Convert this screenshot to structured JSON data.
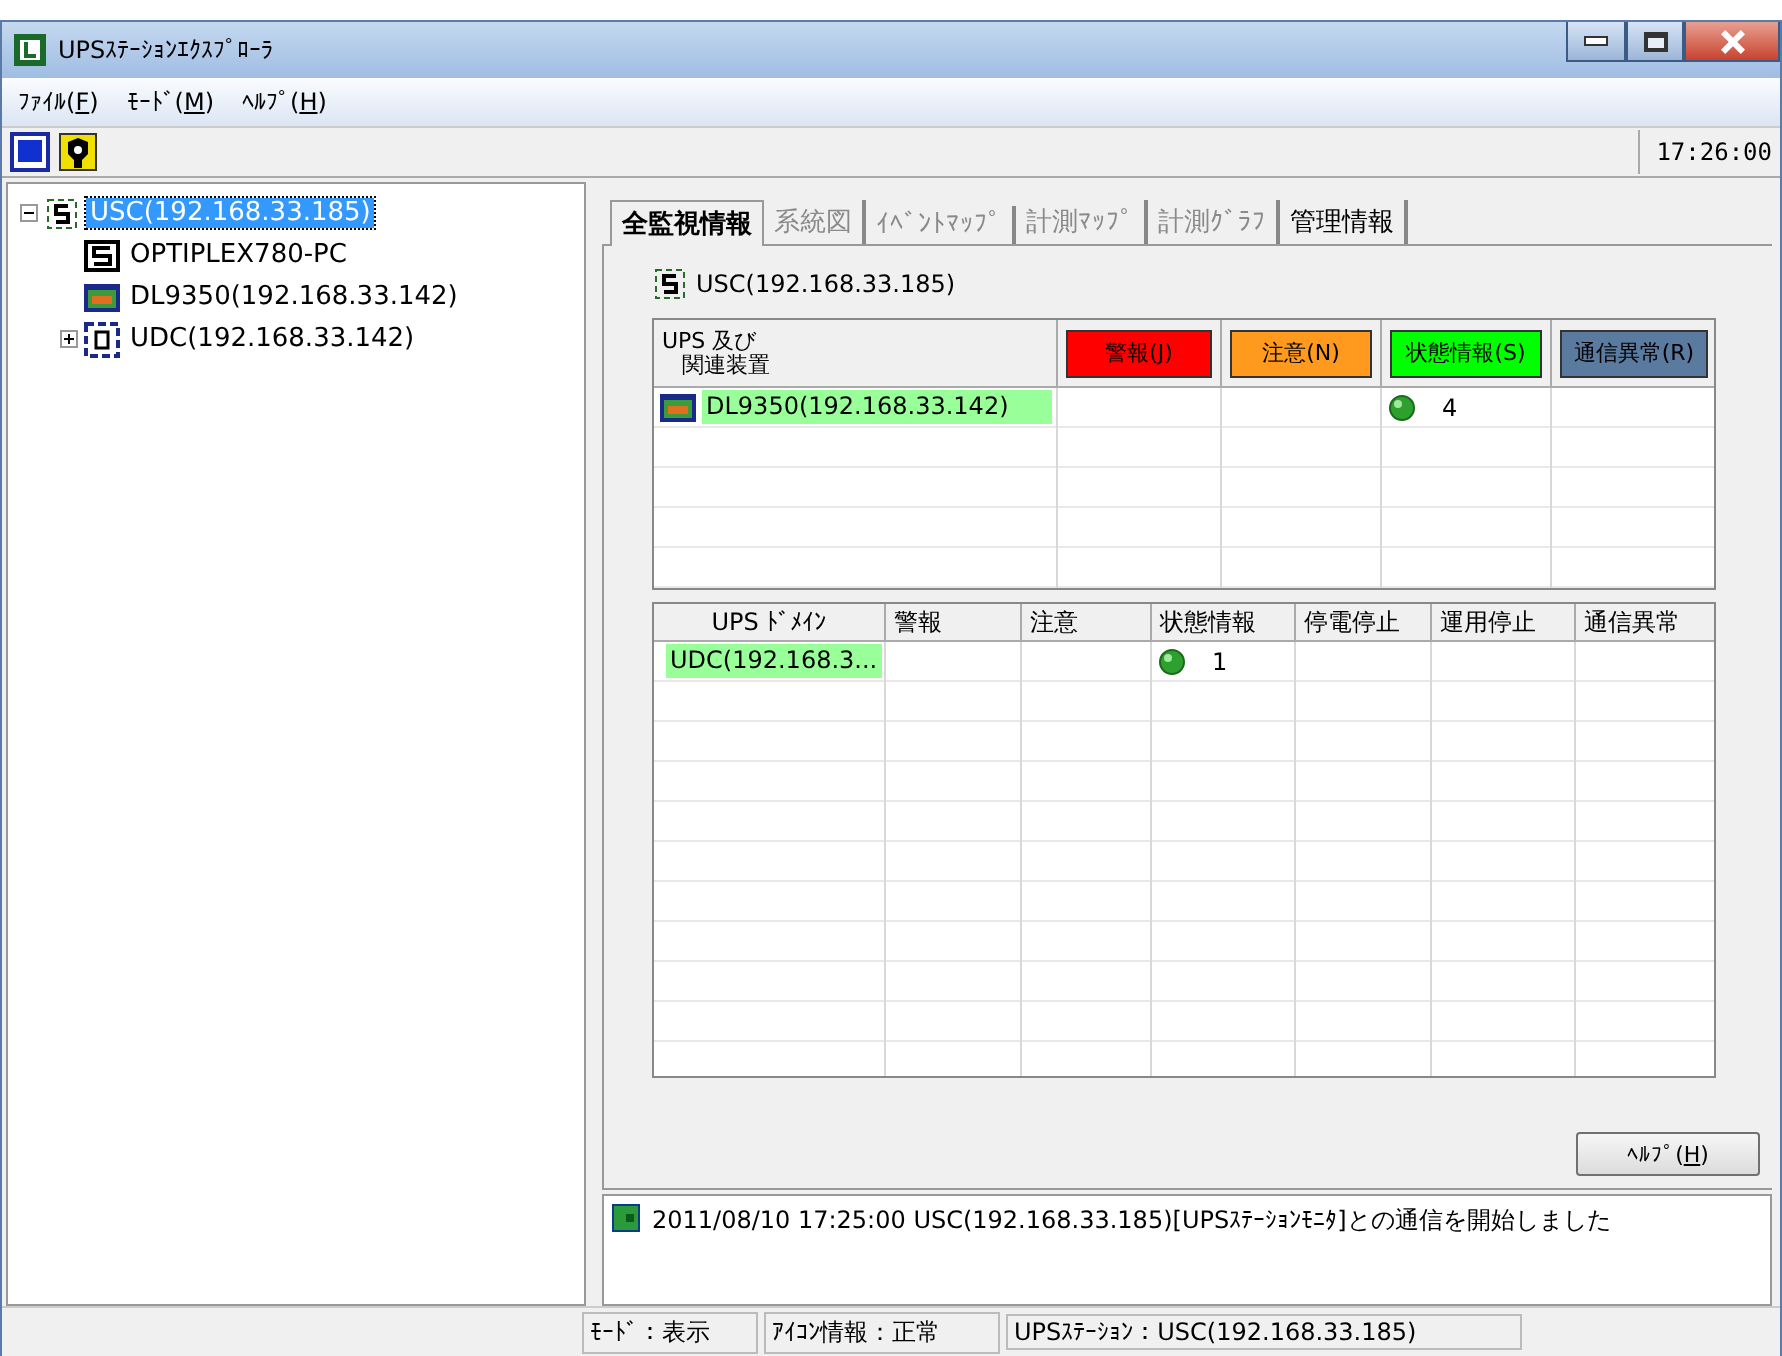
{
  "window": {
    "title": "UPSｽﾃｰｼｮﾝｴｸｽﾌﾟﾛｰﾗ"
  },
  "menu": [
    {
      "prefix": "ﾌｧｲﾙ(",
      "key": "F",
      "suffix": ")"
    },
    {
      "prefix": "ﾓｰﾄﾞ(",
      "key": "M",
      "suffix": ")"
    },
    {
      "prefix": "ﾍﾙﾌﾟ(",
      "key": "H",
      "suffix": ")"
    }
  ],
  "toolbar": {
    "clock": "17:26:00"
  },
  "tree": [
    {
      "label": "USC(192.168.33.185)",
      "kind": "station",
      "expanded": true,
      "selected": true,
      "children": [
        {
          "label": "OPTIPLEX780-PC",
          "kind": "pc",
          "selected": false
        },
        {
          "label": "DL9350(192.168.33.142)",
          "kind": "ups",
          "selected": false
        },
        {
          "label": "UDC(192.168.33.142)",
          "kind": "domain",
          "expanded": false,
          "selected": false
        }
      ]
    }
  ],
  "tabs": [
    {
      "label": "全監視情報",
      "selected": true,
      "disabled": false
    },
    {
      "label": "系統図",
      "selected": false,
      "disabled": true
    },
    {
      "label": "ｲﾍﾞﾝﾄﾏｯﾌﾟ",
      "selected": false,
      "disabled": true
    },
    {
      "label": "計測ﾏｯﾌﾟ",
      "selected": false,
      "disabled": true
    },
    {
      "label": "計測ｸﾞﾗﾌ",
      "selected": false,
      "disabled": true
    },
    {
      "label": "管理情報",
      "selected": false,
      "disabled": false
    }
  ],
  "panel": {
    "station": "USC(192.168.33.185)"
  },
  "device_table": {
    "columns": [
      {
        "lines": [
          "UPS 及び",
          "関連装置"
        ]
      },
      {
        "label": "警報(J)",
        "color": "#ff0000"
      },
      {
        "label": "注意(N)",
        "color": "#ff9a1f"
      },
      {
        "label": "状態情報(S)",
        "color": "#00ff00"
      },
      {
        "label": "通信異常(R)",
        "color": "#5a7aa0"
      }
    ],
    "rows": [
      {
        "name": "DL9350(192.168.33.142)",
        "kind": "ups",
        "highlighted": true,
        "count": "4"
      }
    ]
  },
  "domain_table": {
    "columns": [
      "UPS ﾄﾞﾒｲﾝ",
      "警報",
      "注意",
      "状態情報",
      "停電停止",
      "運用停止",
      "通信異常"
    ],
    "rows": [
      {
        "name": "UDC(192.168.3...",
        "kind": "domain",
        "highlighted": true,
        "count": "1"
      }
    ]
  },
  "help_button": {
    "prefix": "ﾍﾙﾌﾟ(",
    "key": "H",
    "suffix": ")"
  },
  "log": [
    {
      "text": "2011/08/10 17:25:00 USC(192.168.33.185)[UPSｽﾃｰｼｮﾝﾓﾆﾀ]との通信を開始しました"
    }
  ],
  "status_bar": [
    "ﾓｰﾄﾞ：表示",
    "ｱｲｺﾝ情報：正常",
    "UPSｽﾃｰｼｮﾝ：USC(192.168.33.185)"
  ]
}
